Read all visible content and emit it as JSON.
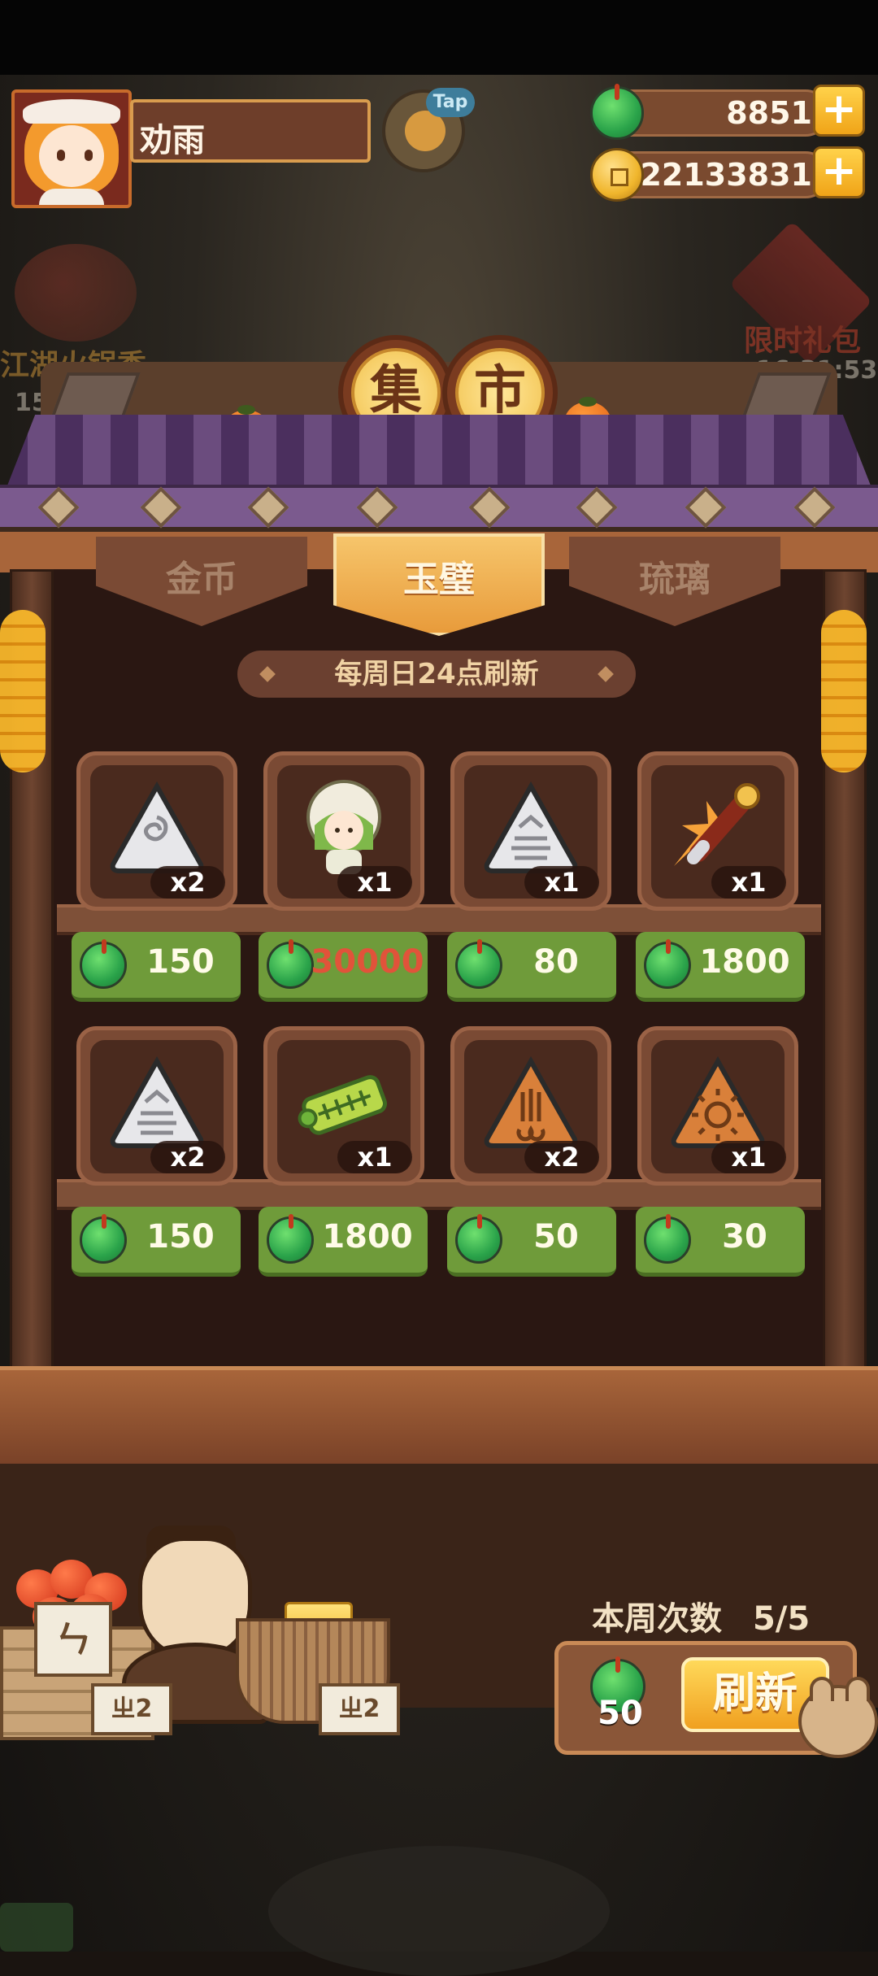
{
  "player": {
    "name": "劝雨"
  },
  "hud": {
    "tap_label": "Tap"
  },
  "currency": {
    "jade": {
      "icon": "jade-disc-icon",
      "amount": "8851"
    },
    "coins": {
      "icon": "gold-coin-icon",
      "amount": "22133831"
    },
    "add_label": "+"
  },
  "background_events": {
    "left": {
      "title": "江湖火锅季",
      "timer": "15天"
    },
    "right": {
      "title": "限时礼包",
      "timer": "16:31:53"
    }
  },
  "market": {
    "title_chars": [
      "集",
      "市"
    ],
    "tabs": [
      {
        "label": "金币",
        "active": false
      },
      {
        "label": "玉璧",
        "active": true
      },
      {
        "label": "琉璃",
        "active": false
      }
    ],
    "refresh_note": "每周日24点刷新",
    "items": [
      {
        "name": "white-triangle-rune-spiral-icon",
        "qty": "x2",
        "price": "150",
        "price_color": "normal"
      },
      {
        "name": "green-haired-girl-avatar-icon",
        "qty": "x1",
        "price": "30000",
        "price_color": "insufficient"
      },
      {
        "name": "white-triangle-rune-lines-icon",
        "qty": "x1",
        "price": "80",
        "price_color": "normal"
      },
      {
        "name": "firework-brush-icon",
        "qty": "x1",
        "price": "1800",
        "price_color": "normal"
      },
      {
        "name": "white-triangle-rune-lines-icon",
        "qty": "x2",
        "price": "150",
        "price_color": "normal"
      },
      {
        "name": "green-scroll-ticket-icon",
        "qty": "x1",
        "price": "1800",
        "price_color": "normal"
      },
      {
        "name": "orange-triangle-rune-figure-icon",
        "qty": "x2",
        "price": "50",
        "price_color": "normal"
      },
      {
        "name": "orange-triangle-rune-sun-icon",
        "qty": "x1",
        "price": "30",
        "price_color": "normal"
      }
    ]
  },
  "stall": {
    "sign_left": "ㄓ2",
    "sign_right": "ㄓ2",
    "scroll_glyph": "ㄣ"
  },
  "weekly": {
    "label": "本周次数",
    "count": "5/5",
    "refresh_cost": "50",
    "refresh_button": "刷新"
  },
  "colors": {
    "price_green": "#6f9b3a",
    "price_insufficient": "#e1533a",
    "tab_active": "#e89b3b",
    "refresh_button": "#f0a020"
  }
}
